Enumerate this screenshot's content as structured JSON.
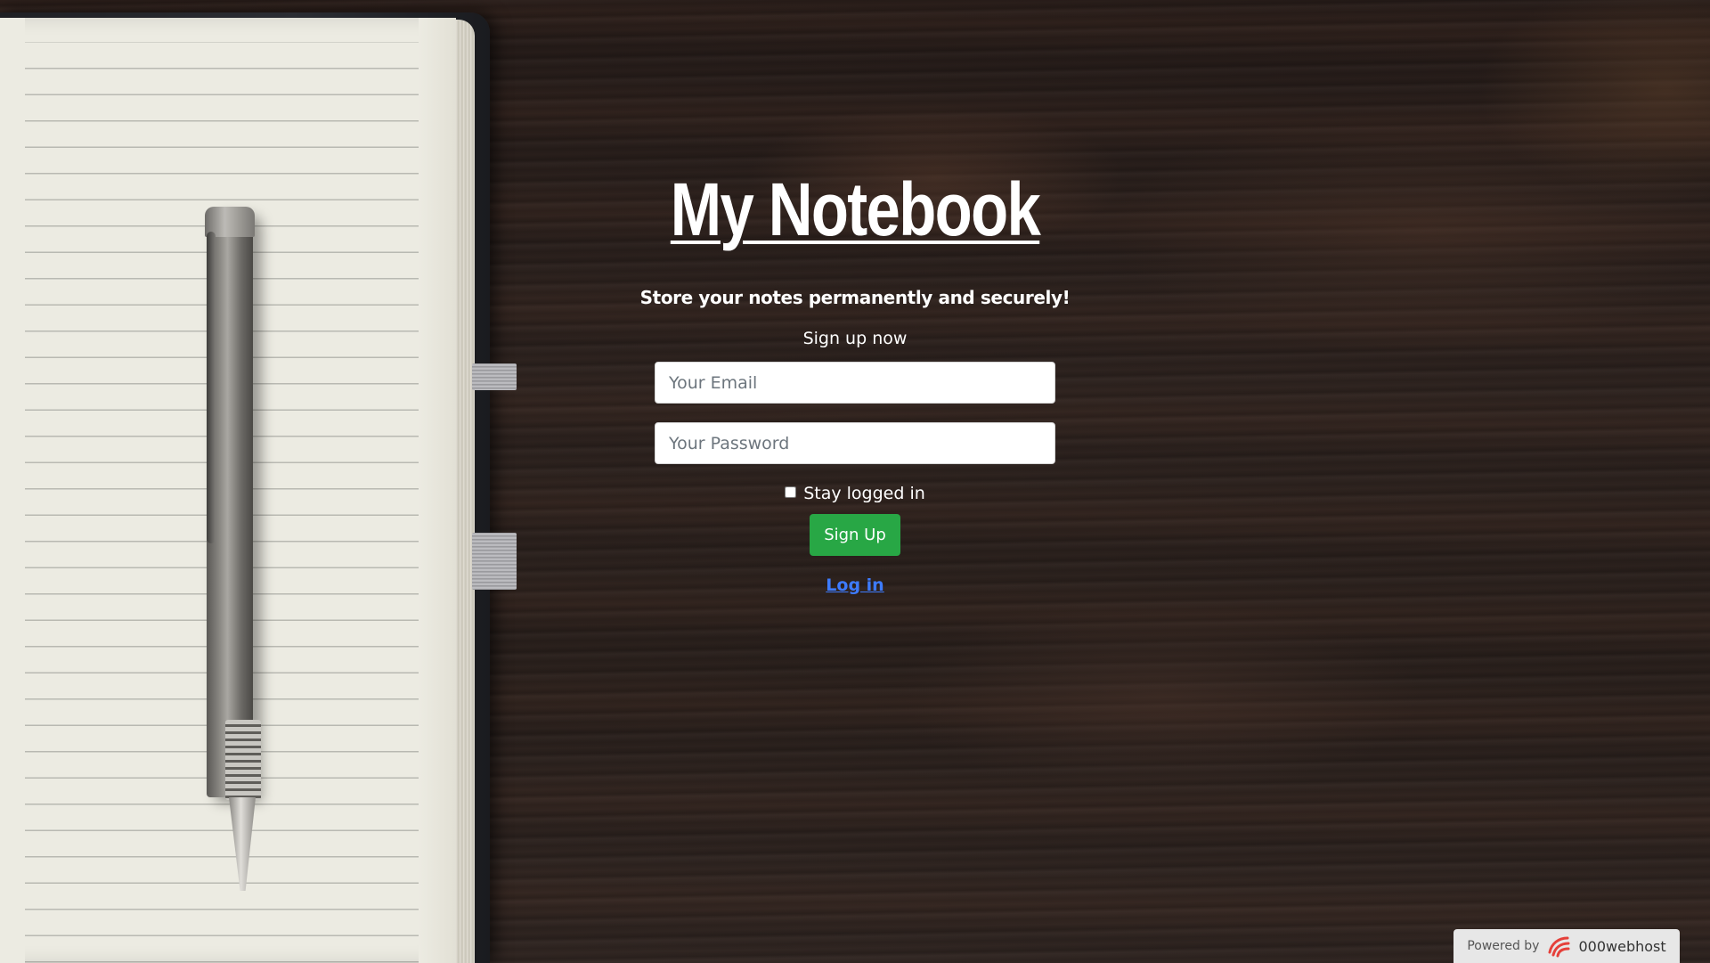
{
  "header": {
    "title": "My Notebook",
    "tagline": "Store your notes permanently and securely!"
  },
  "form": {
    "heading": "Sign up now",
    "email_placeholder": "Your Email",
    "password_placeholder": "Your Password",
    "remember_label": "Stay logged in",
    "remember_checked": false,
    "submit_label": "Sign Up",
    "login_link": "Log in"
  },
  "footer": {
    "powered_label": "Powered by",
    "brand": "000webhost",
    "brand_icon": "000webhost-logo-icon"
  },
  "colors": {
    "accent": "#28a745",
    "link": "#3d7bff"
  }
}
